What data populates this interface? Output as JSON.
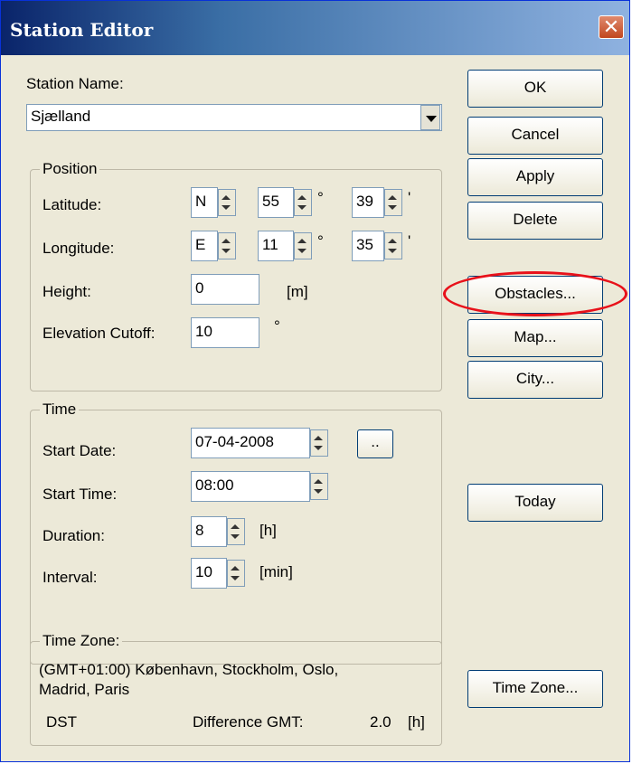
{
  "window": {
    "title": "Station Editor"
  },
  "station": {
    "label": "Station Name:",
    "value": "Sjælland"
  },
  "position": {
    "group_label": "Position",
    "latitude": {
      "label": "Latitude:",
      "hemisphere": "N",
      "degrees": "55",
      "minutes": "39",
      "deg_symbol": "°",
      "min_symbol": "'"
    },
    "longitude": {
      "label": "Longitude:",
      "hemisphere": "E",
      "degrees": "11",
      "minutes": "35",
      "deg_symbol": "°",
      "min_symbol": "'"
    },
    "height": {
      "label": "Height:",
      "value": "0",
      "unit": "[m]"
    },
    "elevation_cutoff": {
      "label": "Elevation Cutoff:",
      "value": "10",
      "unit": "°"
    }
  },
  "time": {
    "group_label": "Time",
    "start_date": {
      "label": "Start Date:",
      "value": "07-04-2008",
      "picker_label": ".."
    },
    "start_time": {
      "label": "Start Time:",
      "value": "08:00"
    },
    "duration": {
      "label": "Duration:",
      "value": "8",
      "unit": "[h]"
    },
    "interval": {
      "label": "Interval:",
      "value": "10",
      "unit": "[min]"
    }
  },
  "timezone": {
    "group_label": "Time Zone:",
    "line1": "(GMT+01:00) København, Stockholm, Oslo,",
    "line2": "Madrid, Paris",
    "dst_label": "DST",
    "diff_label": "Difference GMT:",
    "diff_value": "2.0",
    "diff_unit": "[h]"
  },
  "buttons": {
    "ok": "OK",
    "cancel": "Cancel",
    "apply": "Apply",
    "delete": "Delete",
    "obstacles": "Obstacles...",
    "map": "Map...",
    "city": "City...",
    "today": "Today",
    "time_zone": "Time Zone..."
  },
  "colors": {
    "title_bar": "#0a246a",
    "highlight_ring": "#e8111a",
    "dialog_bg": "#ece9d8"
  }
}
